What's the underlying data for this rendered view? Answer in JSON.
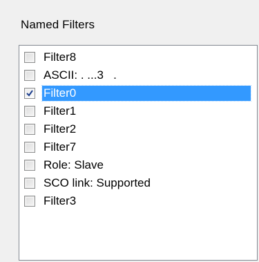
{
  "group": {
    "title": "Named Filters"
  },
  "filters": [
    {
      "label": "Filter8",
      "checked": false,
      "selected": false
    },
    {
      "label": "ASCII: . ...3   .",
      "checked": false,
      "selected": false
    },
    {
      "label": "Filter0",
      "checked": true,
      "selected": true
    },
    {
      "label": "Filter1",
      "checked": false,
      "selected": false
    },
    {
      "label": "Filter2",
      "checked": false,
      "selected": false
    },
    {
      "label": "Filter7",
      "checked": false,
      "selected": false
    },
    {
      "label": "Role: Slave",
      "checked": false,
      "selected": false
    },
    {
      "label": "SCO link: Supported",
      "checked": false,
      "selected": false
    },
    {
      "label": "Filter3",
      "checked": false,
      "selected": false
    }
  ],
  "colors": {
    "selection": "#3399ff",
    "check": "#1a3c8c"
  }
}
